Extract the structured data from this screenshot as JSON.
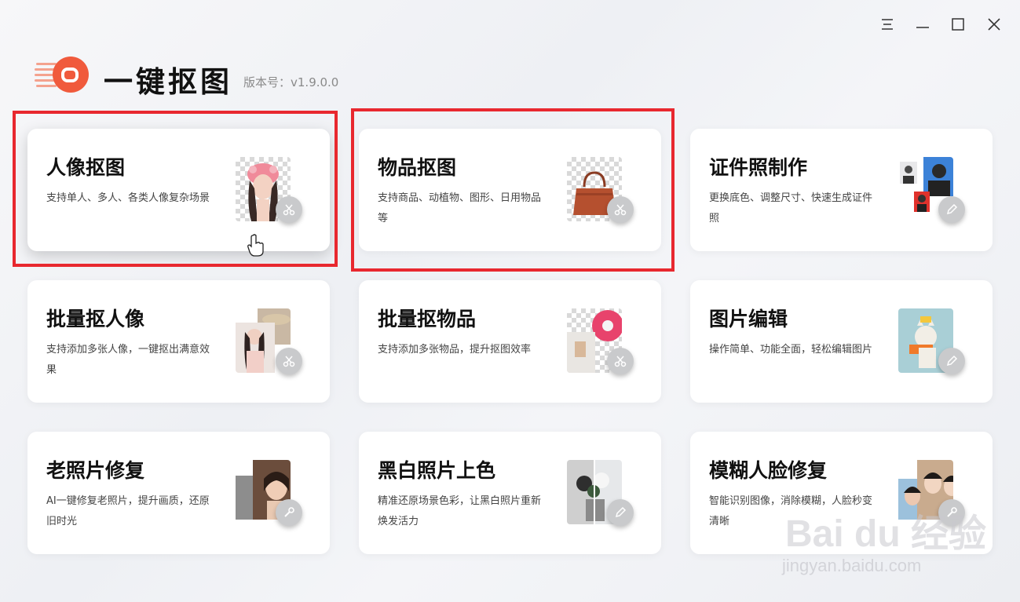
{
  "app": {
    "title": "一键抠图",
    "version": "版本号：v1.9.0.0"
  },
  "window_controls": [
    "menu-icon",
    "minimize-icon",
    "maximize-icon",
    "close-icon"
  ],
  "colors": {
    "highlight": "#e8282f",
    "logo": "#f05a3c"
  },
  "cards": [
    {
      "title": "人像抠图",
      "desc": "支持单人、多人、各类人像复杂场景",
      "icon": "scissors-icon"
    },
    {
      "title": "物品抠图",
      "desc": "支持商品、动植物、图形、日用物品等",
      "icon": "scissors-icon"
    },
    {
      "title": "证件照制作",
      "desc": "更换底色、调整尺寸、快速生成证件照",
      "icon": "pencil-icon"
    },
    {
      "title": "批量抠人像",
      "desc": "支持添加多张人像，一键抠出满意效果",
      "icon": "scissors-icon"
    },
    {
      "title": "批量抠物品",
      "desc": "支持添加多张物品，提升抠图效率",
      "icon": "scissors-icon"
    },
    {
      "title": "图片编辑",
      "desc": "操作简单、功能全面，轻松编辑图片",
      "icon": "pencil-icon"
    },
    {
      "title": "老照片修复",
      "desc": "AI一键修复老照片，提升画质，还原旧时光",
      "icon": "wrench-icon"
    },
    {
      "title": "黑白照片上色",
      "desc": "精准还原场景色彩，让黑白照片重新焕发活力",
      "icon": "pencil-icon"
    },
    {
      "title": "模糊人脸修复",
      "desc": "智能识别图像，消除模糊，人脸秒变清晰",
      "icon": "wrench-icon"
    }
  ],
  "watermark": {
    "line1": "Bai du 经验",
    "line2": "jingyan.baidu.com"
  }
}
